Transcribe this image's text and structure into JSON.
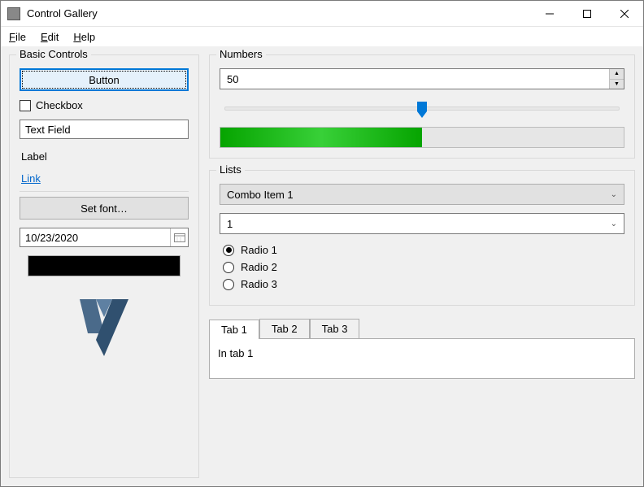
{
  "window": {
    "title": "Control Gallery"
  },
  "menu": {
    "file": "File",
    "edit": "Edit",
    "help": "Help"
  },
  "basic": {
    "legend": "Basic Controls",
    "button_label": "Button",
    "checkbox_label": "Checkbox",
    "textfield_value": "Text Field",
    "label_text": "Label",
    "link_text": "Link",
    "set_font_label": "Set font…",
    "date_value": "10/23/2020",
    "color_value": "#000000"
  },
  "numbers": {
    "legend": "Numbers",
    "spin_value": "50",
    "slider_value": 50,
    "slider_min": 0,
    "slider_max": 100,
    "progress_value": 50,
    "progress_max": 100
  },
  "lists": {
    "legend": "Lists",
    "combo1_selected": "Combo Item 1",
    "combo2_selected": "1",
    "radio1": "Radio 1",
    "radio2": "Radio 2",
    "radio3": "Radio 3",
    "radio_selected": 0
  },
  "tabs": {
    "tab1": "Tab 1",
    "tab2": "Tab 2",
    "tab3": "Tab 3",
    "active": 0,
    "tab1_content": "In tab 1"
  }
}
